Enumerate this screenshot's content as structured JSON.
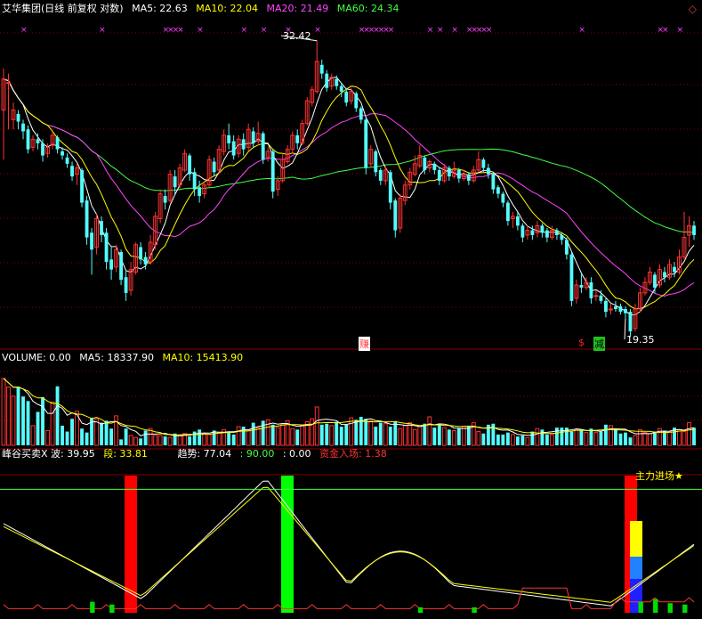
{
  "header": {
    "title": "艾华集团(日线 前复权 对数)",
    "ma": [
      {
        "label": "MA5: 22.63",
        "color": "#ffffff"
      },
      {
        "label": "MA10: 22.04",
        "color": "#ffff00"
      },
      {
        "label": "MA20: 21.49",
        "color": "#ff44ff"
      },
      {
        "label": "MA60: 24.34",
        "color": "#44ff44"
      }
    ]
  },
  "volume_header": {
    "items": [
      {
        "label": "VOLUME: 0.00",
        "color": "#ffffff"
      },
      {
        "label": "MA5: 18337.90",
        "color": "#ffffff"
      },
      {
        "label": "MA10: 15413.90",
        "color": "#ffff00"
      }
    ]
  },
  "indicator_header": {
    "items": [
      {
        "label": "峰谷买卖X 波: 39.95",
        "color": "#ffffff"
      },
      {
        "label": "段: 33.81",
        "color": "#ffff00"
      },
      {
        "label": "趋势: 77.04",
        "color": "#ffffff"
      },
      {
        "label": ": 90.00",
        "color": "#44ff44"
      },
      {
        "label": ": 0.00",
        "color": "#ffffff"
      },
      {
        "label": "资金入场: 1.38",
        "color": "#ff3333"
      }
    ]
  },
  "annotations": {
    "high": "32.42",
    "low": "19.35",
    "mark_sell": "赚",
    "mark_buy": "$",
    "mark_reduce": "减",
    "main_entry": "主力进场★"
  },
  "colors": {
    "up": "#ff3232",
    "down": "#54fcfc",
    "ma5": "#ffffff",
    "ma10": "#ffff00",
    "ma20": "#ff44ff",
    "ma60": "#44ff44",
    "bg": "#000000",
    "grid": "#880000"
  },
  "chart_data": [
    {
      "type": "candlestick",
      "title": "艾华集团(日线 前复权 对数)",
      "candles": [
        [
          28.5,
          30.2,
          26.0,
          30.8
        ],
        [
          30.0,
          30.0,
          27.5,
          30.5
        ],
        [
          28.0,
          28.5,
          27.5,
          28.9
        ],
        [
          28.3,
          27.9,
          27.5,
          28.5
        ],
        [
          27.8,
          27.4,
          27.0,
          28.0
        ],
        [
          27.5,
          26.5,
          26.3,
          27.7
        ],
        [
          26.6,
          27.0,
          26.4,
          27.2
        ],
        [
          27.0,
          26.8,
          26.5,
          27.3
        ],
        [
          26.8,
          26.2,
          25.9,
          27.0
        ],
        [
          26.3,
          26.6,
          26.1,
          26.8
        ],
        [
          26.7,
          27.2,
          26.5,
          27.4
        ],
        [
          27.1,
          26.5,
          26.3,
          27.2
        ],
        [
          26.4,
          26.2,
          26.0,
          26.6
        ],
        [
          26.1,
          25.8,
          25.6,
          26.3
        ],
        [
          25.7,
          25.2,
          25.0,
          25.9
        ],
        [
          25.3,
          25.6,
          24.8,
          25.8
        ],
        [
          25.5,
          24.0,
          23.8,
          25.6
        ],
        [
          24.1,
          22.5,
          22.2,
          24.3
        ],
        [
          22.7,
          22.0,
          21.0,
          22.9
        ],
        [
          22.1,
          23.3,
          21.8,
          23.5
        ],
        [
          23.2,
          22.6,
          22.3,
          23.4
        ],
        [
          22.7,
          21.5,
          21.2,
          22.9
        ],
        [
          21.6,
          21.2,
          20.8,
          22.1
        ],
        [
          21.3,
          22.0,
          21.1,
          22.2
        ],
        [
          21.9,
          20.8,
          20.6,
          22.0
        ],
        [
          20.9,
          20.3,
          20.0,
          21.2
        ],
        [
          20.4,
          21.2,
          20.2,
          21.5
        ],
        [
          21.1,
          22.2,
          21.0,
          22.3
        ],
        [
          22.1,
          21.6,
          21.4,
          22.3
        ],
        [
          21.7,
          21.4,
          21.2,
          21.9
        ],
        [
          21.5,
          22.3,
          21.4,
          22.6
        ],
        [
          22.2,
          23.4,
          22.0,
          23.6
        ],
        [
          23.3,
          24.4,
          23.1,
          24.6
        ],
        [
          24.3,
          24.0,
          23.7,
          24.6
        ],
        [
          24.1,
          25.3,
          24.0,
          25.5
        ],
        [
          25.2,
          24.7,
          24.4,
          25.5
        ],
        [
          24.8,
          25.6,
          24.6,
          25.8
        ],
        [
          25.5,
          26.3,
          25.4,
          26.5
        ],
        [
          26.2,
          25.3,
          25.0,
          26.3
        ],
        [
          25.4,
          24.6,
          24.3,
          25.6
        ],
        [
          24.7,
          24.3,
          24.0,
          25.0
        ],
        [
          24.4,
          24.8,
          24.2,
          25.0
        ],
        [
          24.8,
          26.0,
          24.7,
          26.2
        ],
        [
          25.9,
          25.4,
          25.2,
          26.1
        ],
        [
          25.5,
          26.5,
          25.3,
          26.7
        ],
        [
          26.4,
          27.2,
          26.2,
          27.5
        ],
        [
          27.2,
          26.8,
          26.5,
          27.8
        ],
        [
          26.9,
          26.2,
          26.0,
          27.2
        ],
        [
          26.3,
          27.0,
          26.1,
          27.2
        ],
        [
          27.0,
          26.5,
          26.2,
          27.3
        ],
        [
          26.6,
          27.5,
          26.4,
          27.8
        ],
        [
          27.4,
          26.8,
          26.6,
          27.6
        ],
        [
          26.9,
          27.3,
          26.7,
          27.9
        ],
        [
          27.3,
          26.0,
          25.8,
          27.4
        ],
        [
          26.1,
          26.4,
          25.9,
          26.6
        ],
        [
          26.4,
          24.5,
          24.2,
          26.5
        ],
        [
          24.6,
          25.0,
          24.3,
          25.2
        ],
        [
          25.0,
          26.0,
          24.9,
          26.3
        ],
        [
          25.9,
          26.5,
          25.8,
          26.7
        ],
        [
          26.5,
          27.2,
          26.3,
          27.4
        ],
        [
          27.2,
          26.8,
          26.5,
          27.5
        ],
        [
          26.8,
          27.8,
          26.7,
          28.0
        ],
        [
          27.8,
          29.0,
          27.7,
          29.2
        ],
        [
          28.9,
          29.6,
          28.7,
          29.8
        ],
        [
          29.5,
          31.2,
          29.4,
          32.42
        ],
        [
          31.0,
          30.5,
          30.2,
          31.3
        ],
        [
          30.5,
          29.7,
          29.5,
          30.7
        ],
        [
          29.8,
          30.3,
          29.6,
          30.5
        ],
        [
          30.2,
          29.8,
          29.6,
          30.4
        ],
        [
          29.8,
          29.5,
          29.2,
          30.0
        ],
        [
          29.5,
          28.9,
          28.7,
          29.7
        ],
        [
          29.0,
          29.5,
          28.8,
          29.7
        ],
        [
          29.4,
          28.6,
          28.4,
          29.5
        ],
        [
          28.6,
          28.0,
          27.8,
          28.7
        ],
        [
          28.0,
          25.6,
          25.3,
          28.1
        ],
        [
          25.8,
          26.5,
          25.6,
          26.7
        ],
        [
          26.4,
          25.4,
          25.2,
          26.5
        ],
        [
          25.5,
          25.0,
          24.8,
          25.6
        ],
        [
          25.0,
          25.5,
          24.8,
          25.7
        ],
        [
          25.4,
          24.0,
          23.7,
          25.5
        ],
        [
          24.1,
          22.8,
          22.5,
          24.2
        ],
        [
          22.9,
          24.2,
          22.7,
          24.4
        ],
        [
          24.1,
          24.8,
          23.9,
          25.0
        ],
        [
          24.8,
          25.4,
          24.6,
          25.6
        ],
        [
          25.3,
          25.8,
          25.2,
          26.2
        ],
        [
          25.7,
          26.2,
          25.6,
          26.7
        ],
        [
          26.1,
          25.5,
          25.3,
          26.2
        ],
        [
          25.6,
          25.9,
          25.4,
          26.0
        ],
        [
          25.8,
          25.5,
          25.3,
          25.9
        ],
        [
          25.5,
          25.0,
          24.8,
          25.6
        ],
        [
          25.0,
          25.6,
          24.9,
          25.8
        ],
        [
          25.6,
          25.2,
          25.0,
          25.7
        ],
        [
          25.2,
          25.5,
          25.1,
          25.9
        ],
        [
          25.5,
          25.1,
          24.9,
          25.6
        ],
        [
          25.1,
          25.3,
          25.0,
          25.5
        ],
        [
          25.3,
          25.0,
          24.8,
          25.4
        ],
        [
          25.0,
          25.5,
          24.9,
          25.7
        ],
        [
          25.5,
          26.0,
          25.4,
          26.4
        ],
        [
          26.0,
          25.6,
          25.4,
          26.1
        ],
        [
          25.6,
          25.3,
          25.1,
          25.8
        ],
        [
          25.3,
          24.6,
          24.4,
          25.4
        ],
        [
          24.7,
          24.4,
          24.2,
          24.8
        ],
        [
          24.4,
          24.0,
          23.8,
          24.5
        ],
        [
          24.0,
          23.2,
          23.0,
          24.1
        ],
        [
          23.3,
          23.4,
          22.9,
          23.6
        ],
        [
          23.4,
          23.0,
          22.8,
          23.6
        ],
        [
          23.0,
          22.5,
          22.3,
          23.1
        ],
        [
          22.6,
          22.8,
          22.4,
          23.0
        ],
        [
          22.8,
          22.6,
          22.4,
          23.0
        ],
        [
          22.7,
          23.0,
          22.5,
          23.2
        ],
        [
          23.0,
          22.7,
          22.5,
          23.1
        ],
        [
          22.8,
          22.5,
          22.3,
          22.9
        ],
        [
          22.5,
          22.8,
          22.4,
          23.0
        ],
        [
          22.8,
          22.6,
          22.4,
          22.9
        ],
        [
          22.6,
          22.4,
          22.2,
          22.7
        ],
        [
          22.4,
          21.8,
          21.6,
          22.5
        ],
        [
          21.8,
          20.0,
          19.8,
          21.9
        ],
        [
          20.1,
          20.6,
          19.9,
          20.8
        ],
        [
          20.6,
          20.5,
          20.3,
          21.1
        ],
        [
          20.5,
          20.7,
          20.4,
          20.9
        ],
        [
          20.7,
          20.1,
          19.9,
          20.9
        ],
        [
          20.2,
          20.2,
          20.0,
          20.4
        ],
        [
          20.2,
          20.0,
          19.9,
          20.4
        ],
        [
          20.0,
          19.6,
          19.4,
          20.1
        ],
        [
          19.7,
          19.7,
          19.5,
          19.9
        ],
        [
          19.8,
          19.7,
          19.6,
          20.0
        ],
        [
          19.8,
          19.6,
          19.5,
          19.9
        ],
        [
          19.7,
          19.55,
          19.35,
          19.8
        ],
        [
          19.6,
          18.9,
          18.7,
          19.7
        ],
        [
          19.0,
          19.7,
          18.9,
          19.9
        ],
        [
          19.7,
          20.3,
          19.6,
          20.5
        ],
        [
          20.3,
          20.7,
          20.2,
          20.9
        ],
        [
          20.7,
          21.1,
          20.6,
          21.3
        ],
        [
          21.0,
          20.5,
          20.3,
          21.1
        ],
        [
          20.6,
          21.2,
          20.5,
          21.4
        ],
        [
          21.1,
          20.9,
          20.7,
          21.3
        ],
        [
          20.9,
          21.4,
          20.8,
          21.6
        ],
        [
          21.3,
          21.1,
          20.9,
          21.5
        ],
        [
          21.1,
          21.7,
          21.0,
          22.0
        ],
        [
          21.7,
          22.5,
          21.6,
          23.6
        ],
        [
          22.6,
          23.0,
          22.1,
          23.4
        ],
        [
          23.0,
          22.6,
          22.4,
          23.2
        ]
      ],
      "high_label": "32.42",
      "low_label": "19.35",
      "series": [
        {
          "name": "MA5",
          "value": 22.63
        },
        {
          "name": "MA10",
          "value": 22.04
        },
        {
          "name": "MA20",
          "value": 21.49
        },
        {
          "name": "MA60",
          "value": 24.34
        }
      ]
    },
    {
      "type": "bar",
      "title": "VOLUME",
      "values": [
        20400,
        17800,
        15000,
        17900,
        14900,
        13500,
        6000,
        10200,
        14700,
        4500,
        13200,
        18000,
        6000,
        4200,
        8100,
        10400,
        5100,
        3900,
        8400,
        8100,
        6900,
        7500,
        5100,
        9000,
        1800,
        5100,
        3000,
        2400,
        2100,
        4500,
        5100,
        3000,
        3000,
        2700,
        2400,
        3600,
        3000,
        3600,
        2700,
        4200,
        4800,
        3600,
        3300,
        4500,
        3900,
        4800,
        4200,
        3300,
        5700,
        5700,
        4800,
        6900,
        5400,
        7500,
        7800,
        6300,
        5400,
        6300,
        7500,
        5100,
        4800,
        6000,
        7200,
        8100,
        11700,
        6300,
        6600,
        6000,
        7200,
        5700,
        6300,
        8400,
        7800,
        8700,
        8100,
        7500,
        5700,
        6900,
        6600,
        5700,
        7200,
        5100,
        6000,
        6900,
        4800,
        5700,
        6600,
        8700,
        5400,
        6300,
        5400,
        4800,
        4500,
        5100,
        5700,
        6000,
        6900,
        4200,
        3600,
        6300,
        6600,
        3300,
        3300,
        3900,
        3300,
        2700,
        3000,
        2400,
        4200,
        5100,
        4800,
        3300,
        3300,
        5400,
        5400,
        5400,
        4200,
        4800,
        4500,
        3900,
        5100,
        3900,
        4200,
        6300,
        6000,
        4800,
        3600,
        3900,
        2400,
        3000,
        4800,
        3900,
        3600,
        4200,
        5100,
        4500,
        4200,
        5400,
        4800,
        4200,
        6900,
        5400,
        5400,
        5100,
        3600,
        8400
      ],
      "ylim": [
        0,
        25000
      ]
    },
    {
      "type": "line",
      "title": "峰谷买卖X",
      "series": [
        {
          "name": "波",
          "last": 39.95
        },
        {
          "name": "段",
          "last": 33.81
        },
        {
          "name": "趋势",
          "last": 77.04
        },
        {
          "name": "资金入场",
          "last": 1.38
        }
      ],
      "lines": [
        90.0,
        0.0
      ],
      "ylim": [
        0,
        100
      ]
    }
  ]
}
